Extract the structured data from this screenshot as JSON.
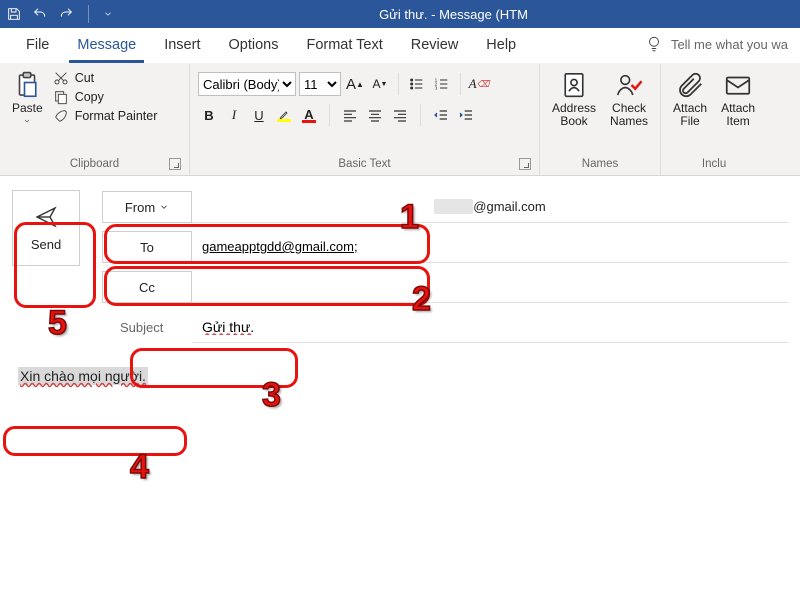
{
  "title": "Gửi thư.  -  Message (HTM",
  "qat": {
    "save": "save-icon",
    "undo": "undo-icon",
    "redo": "redo-icon"
  },
  "tabs": [
    "File",
    "Message",
    "Insert",
    "Options",
    "Format Text",
    "Review",
    "Help"
  ],
  "active_tab": "Message",
  "tell_me": "Tell me what you wa",
  "ribbon": {
    "clipboard": {
      "label": "Clipboard",
      "paste": "Paste",
      "cut": "Cut",
      "copy": "Copy",
      "format_painter": "Format Painter"
    },
    "basic_text": {
      "label": "Basic Text",
      "font_name": "Calibri (Body)",
      "font_size": "11",
      "bold": "B",
      "italic": "I",
      "underline": "U"
    },
    "names": {
      "label": "Names",
      "address_book": "Address\nBook",
      "check_names": "Check\nNames"
    },
    "include": {
      "label": "Inclu",
      "attach_file": "Attach\nFile",
      "attach_item": "Attach\nItem"
    }
  },
  "compose": {
    "send": "Send",
    "from_label": "From",
    "from_value": "@gmail.com",
    "from_masked_prefix": "xxxxxx",
    "to_label": "To",
    "to_value": "gameapptgdd@gmail.com;",
    "cc_label": "Cc",
    "cc_value": "",
    "subject_label": "Subject",
    "subject_value": "Gửi thư.",
    "body": "Xin chào mọi người."
  },
  "annotations": {
    "n1": "1",
    "n2": "2",
    "n3": "3",
    "n4": "4",
    "n5": "5"
  }
}
